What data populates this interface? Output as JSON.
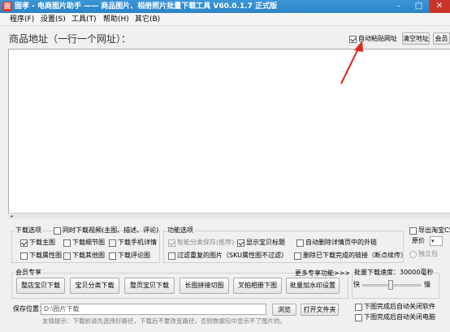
{
  "titlebar": {
    "title": "固孝 - 电商图片助手 —— 商品图片、相册照片批量下载工具 V60.0.1.7 正式版",
    "icon_glyph": "固",
    "min_glyph": "–",
    "max_glyph": "□",
    "close_glyph": "✕"
  },
  "menu": [
    "程序(F)",
    "设置(S)",
    "工具(T)",
    "帮助(H)",
    "其它(B)"
  ],
  "url_area": {
    "label": "商品地址（一行一个网址）：",
    "auto_paste_label": "自动粘贴网址",
    "auto_paste_checked": true,
    "clear_button": "清空地址",
    "cut_button": "会员"
  },
  "download_options": {
    "title": "下载选项",
    "video_option": "同时下载视频(主图、描述、评论)",
    "items": [
      {
        "label": "下载主图",
        "checked": true
      },
      {
        "label": "下载细节图",
        "checked": false
      },
      {
        "label": "下载手机详情",
        "checked": false
      },
      {
        "label": "下载属性图",
        "checked": false
      },
      {
        "label": "下载其他图",
        "checked": false
      },
      {
        "label": "下载评论图",
        "checked": false
      }
    ]
  },
  "function_options": {
    "title": "功能选项",
    "items": [
      {
        "label": "智能分类保存(推荐)",
        "checked": true,
        "disabled": true
      },
      {
        "label": "显示宝贝标题",
        "checked": true,
        "disabled": false
      },
      {
        "label": "自动删除详情页中的外链",
        "checked": false,
        "disabled": false
      },
      {
        "label": "过滤重复的图片（SKU属性图不过滤）",
        "checked": false,
        "disabled": false
      },
      {
        "label": "删除已下载完成的链接（断点续传）",
        "checked": false,
        "disabled": false
      }
    ]
  },
  "right_panel": {
    "export_label": "导出淘宝CS",
    "price_label": "原价",
    "price_select": "▾",
    "standalone_label": "独立包"
  },
  "member": {
    "title": "会员专享",
    "more_link": "更多专享功能>>>",
    "buttons": [
      "整店宝贝下载",
      "宝贝分类下载",
      "整页宝贝下载",
      "长图拼接切图",
      "叉拍相册下图",
      "批量加水印设置"
    ]
  },
  "speed": {
    "title": "批量下载速度：30000毫秒",
    "slow": "快",
    "fast": "慢",
    "level": 0.5
  },
  "after_options": [
    "下图完成后自动关闭软件",
    "下图完成后自动关闭电脑"
  ],
  "save": {
    "label": "保存位置：",
    "path": "D:\\图片下载",
    "browse_button": "浏览",
    "open_button": "打开文件夹"
  },
  "tip": "友情提示：下载前请先选择好路径，下载后不要改变路径，否则数据包中显示不了图片的。",
  "annotation": {
    "arrow_color": "#e0281b"
  },
  "colors": {
    "titlebar": "#2b84c6",
    "close": "#c8352a"
  }
}
